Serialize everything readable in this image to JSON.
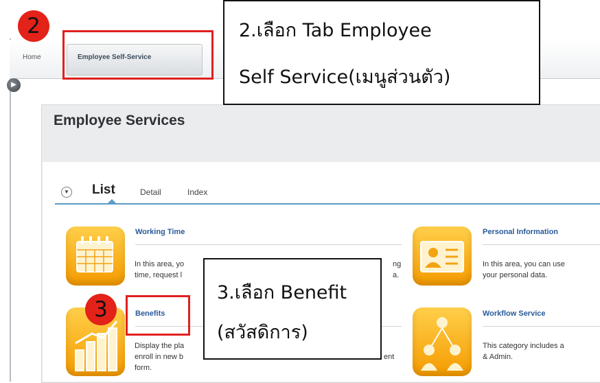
{
  "nav": {
    "home_label": "Home",
    "active_tab_label": "Employee Self-Service"
  },
  "page": {
    "title": "Employee Services"
  },
  "view_tabs": {
    "list": "List",
    "detail": "Detail",
    "index": "Index"
  },
  "tiles": [
    {
      "title": "Working Time",
      "line1": "In this area, yo",
      "line1_tail": "ng",
      "line2": "time, request l",
      "line2_tail": "a."
    },
    {
      "title": "Personal Information",
      "line1": "In this area, you can use",
      "line2": "your personal data."
    },
    {
      "title": "Benefits",
      "line1": "Display the pla",
      "line2": "enroll in new b",
      "line2_tail": "ent",
      "line3": "form."
    },
    {
      "title": "Workflow Service",
      "line1": "This category includes a",
      "line2": "& Admin."
    }
  ],
  "annotations": {
    "step2_badge": "2",
    "step2_text_1": "2.เลือก Tab Employee",
    "step2_text_2": "Self Service(เมนูส่วนตัว)",
    "step3_badge": "3",
    "step3_text_1": "3.เลือก Benefit",
    "step3_text_2": "(สวัสดิการ)"
  },
  "colors": {
    "accent_orange": "#f59b00",
    "link_blue": "#2a5a9a",
    "annotation_red": "#e02020",
    "tab_underline": "#5d9bc9"
  }
}
